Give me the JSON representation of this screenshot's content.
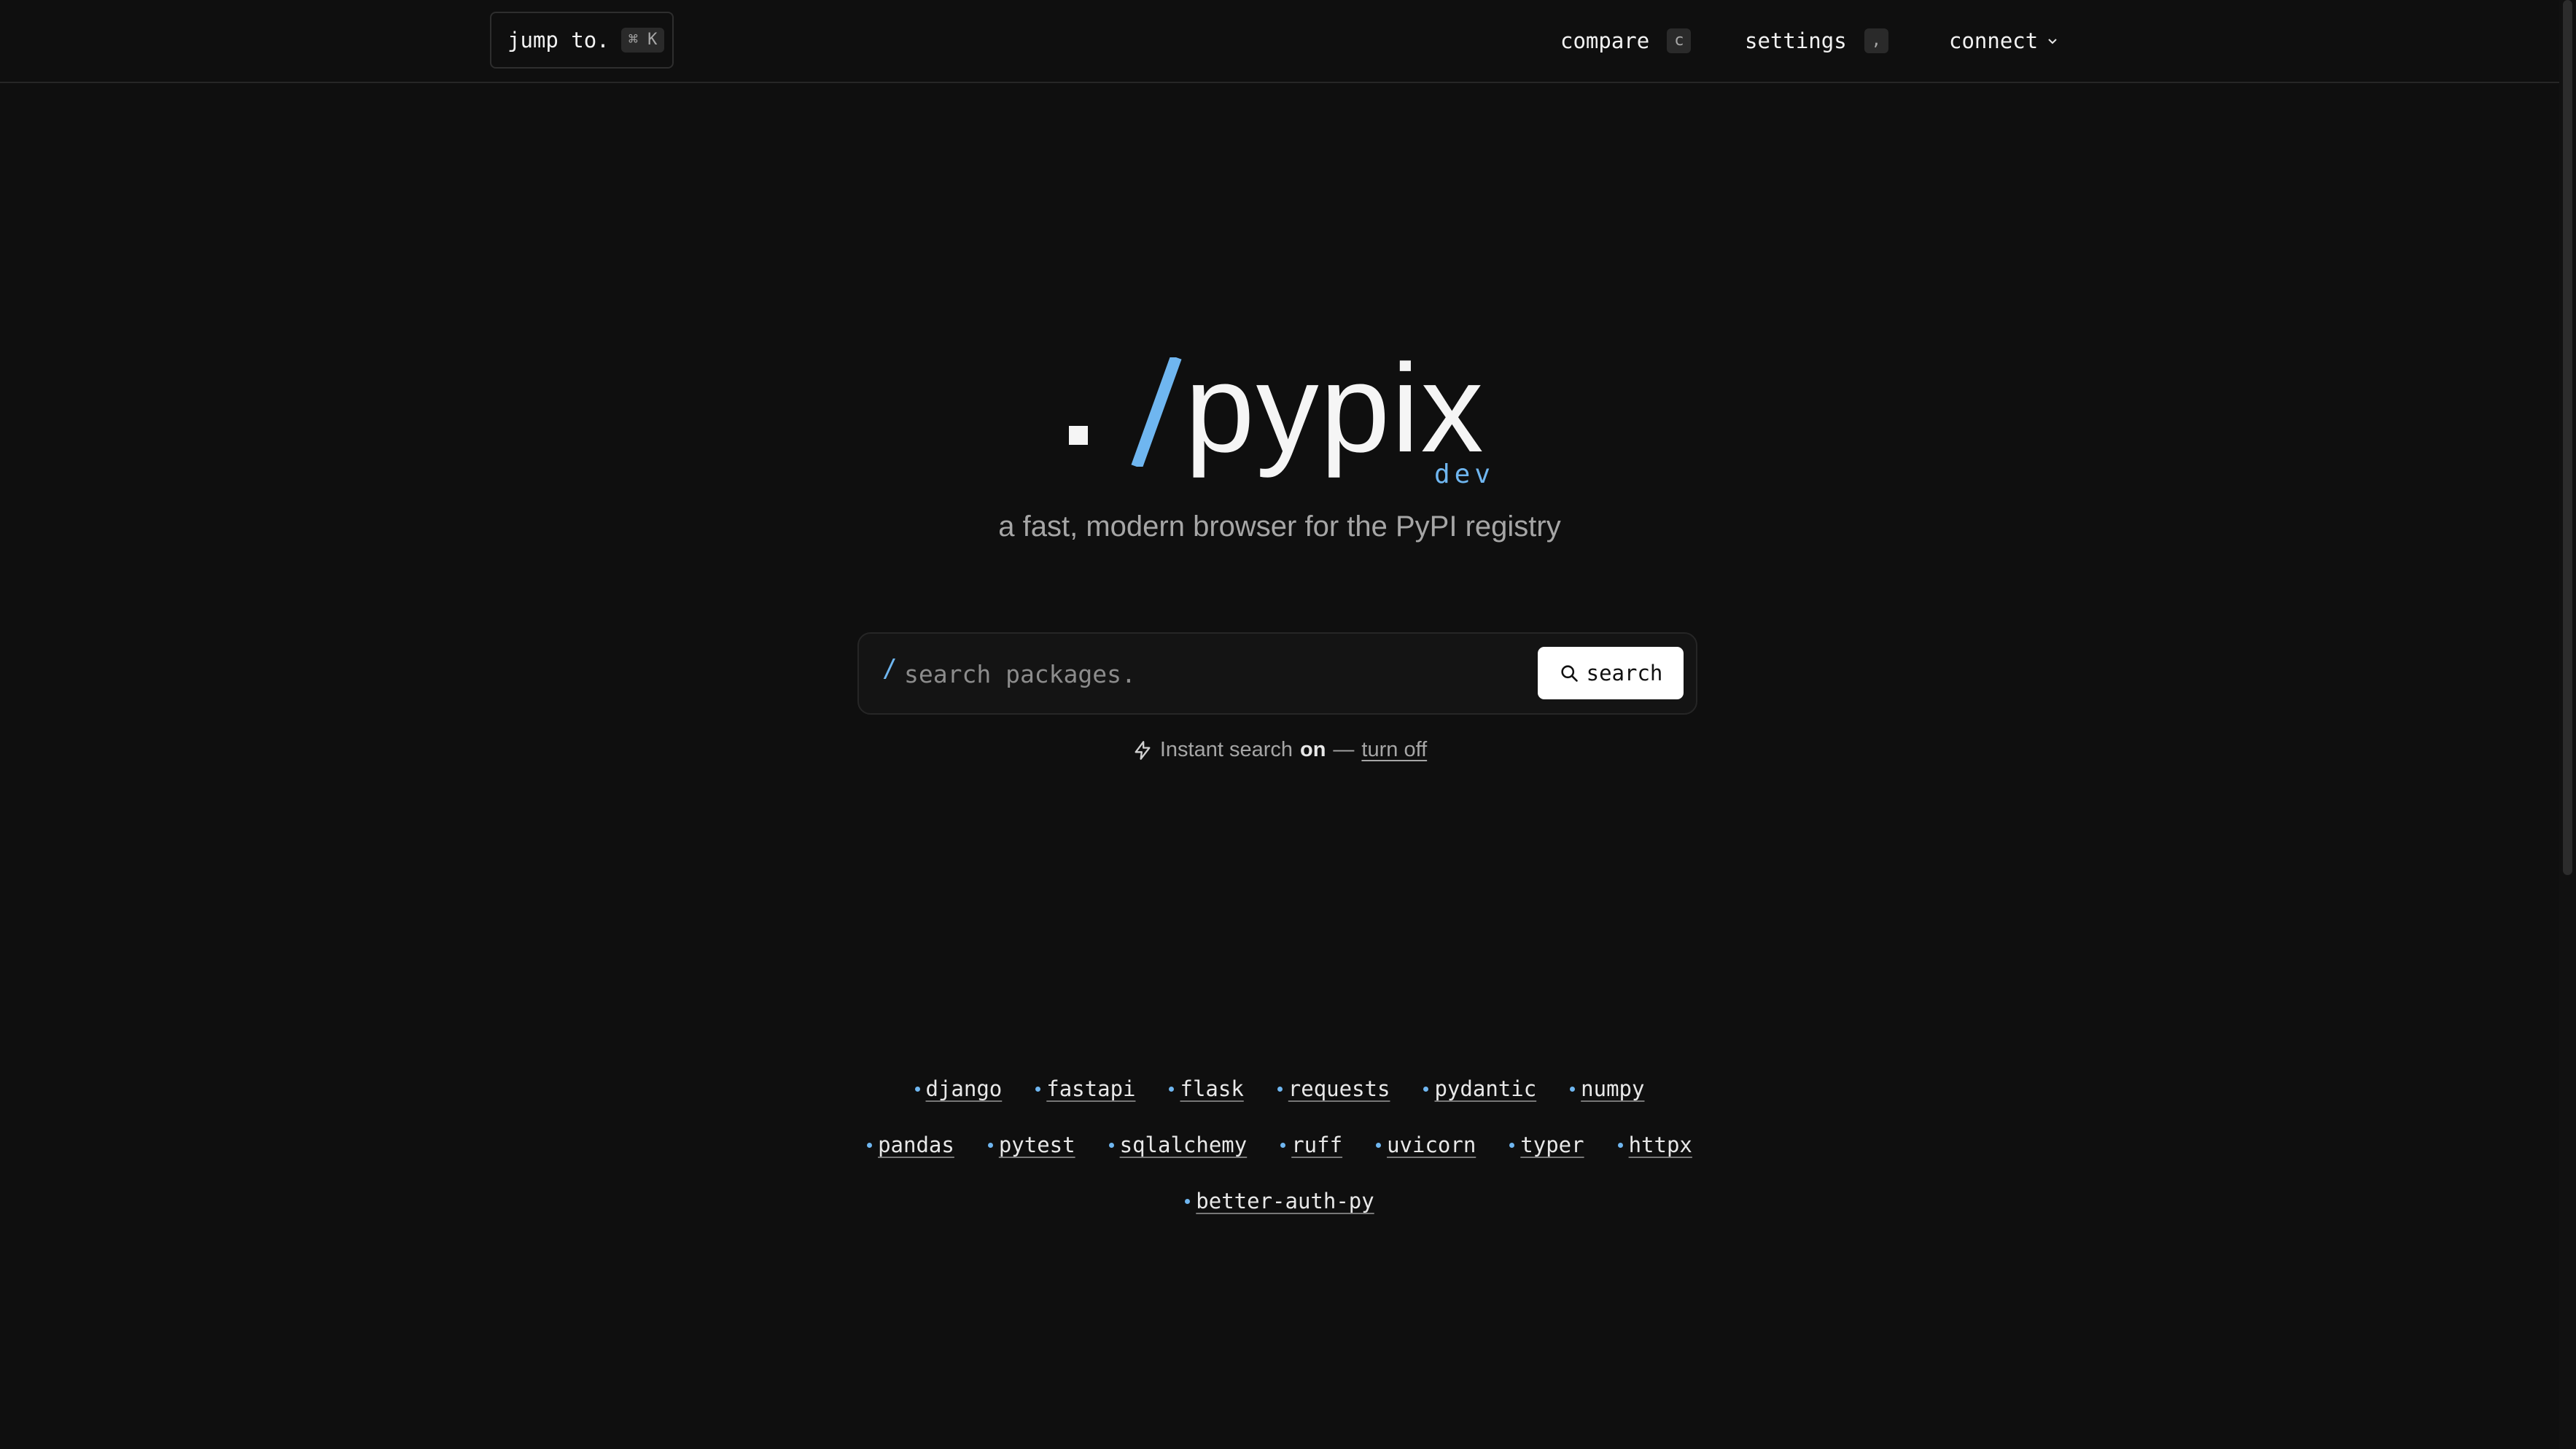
{
  "topbar": {
    "jump": {
      "label": "jump to.",
      "shortcut": "⌘ K"
    },
    "nav": [
      {
        "label": "compare",
        "shortcut": "c"
      },
      {
        "label": "settings",
        "shortcut": ","
      },
      {
        "label": "connect",
        "icon": "chevron-down-icon"
      }
    ]
  },
  "logo": {
    "dot": ".",
    "slash": "/",
    "word": "pypix",
    "badge": "dev"
  },
  "tagline": "a fast, modern browser for the PyPI registry",
  "search": {
    "prefix": "/",
    "placeholder": "search packages.",
    "value": "",
    "button_label": "search",
    "button_icon": "search-icon"
  },
  "instant": {
    "icon": "lightning-icon",
    "label": "Instant search",
    "state": "on",
    "separator": "—",
    "toggle_label": "turn off"
  },
  "popular_packages": {
    "row1": [
      "django",
      "fastapi",
      "flask",
      "requests",
      "pydantic",
      "numpy"
    ],
    "row2": [
      "pandas",
      "pytest",
      "sqlalchemy",
      "ruff",
      "uvicorn",
      "typer",
      "httpx"
    ],
    "row3": [
      "better-auth-py"
    ]
  },
  "colors": {
    "background": "#0f0f0f",
    "accent": "#6fb6f0",
    "text": "#e8e8e8",
    "muted": "#a6a6a6"
  }
}
